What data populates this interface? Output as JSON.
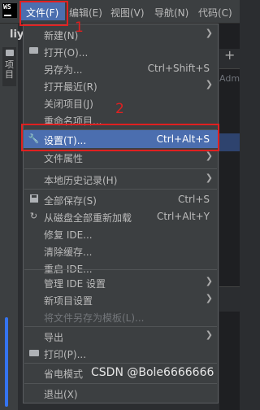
{
  "menubar": {
    "logo": "WS",
    "file": "文件(F)",
    "edit": "编辑(E)",
    "view": "视图(V)",
    "navigate": "导航(N)",
    "code": "代码(C)"
  },
  "background": {
    "project_title": "liy",
    "tool_tab": "项目",
    "right_text": "Adm"
  },
  "menu": {
    "new": {
      "label": "新建(N)"
    },
    "open": {
      "label": "打开(O)..."
    },
    "save_as": {
      "label": "另存为...",
      "shortcut": "Ctrl+Shift+S"
    },
    "open_recent": {
      "label": "打开最近(R)"
    },
    "close_project": {
      "label": "关闭项目(J)"
    },
    "rename_project": {
      "label": "重命名项目..."
    },
    "settings": {
      "label": "设置(T)...",
      "shortcut": "Ctrl+Alt+S"
    },
    "file_properties": {
      "label": "文件属性"
    },
    "local_history": {
      "label": "本地历史记录(H)"
    },
    "save_all": {
      "label": "全部保存(S)",
      "shortcut": "Ctrl+S"
    },
    "reload": {
      "label": "从磁盘全部重新加载",
      "shortcut": "Ctrl+Alt+Y"
    },
    "repair_ide": {
      "label": "修复 IDE..."
    },
    "invalidate_caches": {
      "label": "清除缓存..."
    },
    "restart_ide": {
      "label": "重启 IDE..."
    },
    "manage_ide_settings": {
      "label": "管理 IDE 设置"
    },
    "new_project_settings": {
      "label": "新项目设置"
    },
    "save_as_template": {
      "label": "将文件另存为模板(L)..."
    },
    "export": {
      "label": "导出"
    },
    "print": {
      "label": "打印(P)..."
    },
    "power_save": {
      "label": "省电模式"
    },
    "exit": {
      "label": "退出(X)"
    }
  },
  "annotations": {
    "step1": "1",
    "step2": "2"
  },
  "watermark": "CSDN @Bole6666666",
  "colors": {
    "highlight": "#4b6eaf",
    "annotation": "#e02020",
    "menu_bg": "#3c3f41"
  }
}
